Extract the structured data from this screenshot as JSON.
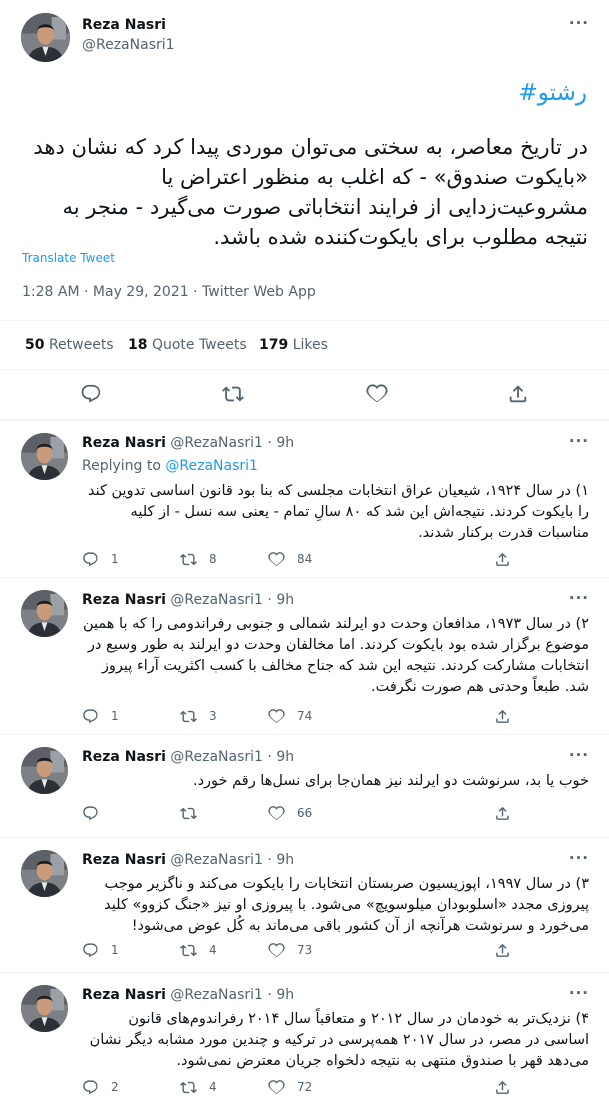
{
  "main_tweet": {
    "author_name": "Reza Nasri",
    "author_handle": "@RezaNasri1",
    "hashtag": "#رشتو",
    "text": "در تاریخ معاصر، به سختی می‌توان موردی پیدا کرد که نشان دهد «بایکوت صندوق» - که اغلب به منظور اعتراض یا مشروعیت‌زدایی از فرایند انتخاباتی صورت می‌گیرد - منجر به نتیجه مطلوب برای بایکوت‌کننده شده باشد.",
    "translate_label": "Translate Tweet",
    "time": "1:28 AM",
    "dot": "·",
    "date": "May 29, 2021",
    "source": "Twitter Web App",
    "retweets_count": "50",
    "retweets_label": "Retweets",
    "quotes_count": "18",
    "quotes_label": "Quote Tweets",
    "likes_count": "179",
    "likes_label": "Likes",
    "more_label": "···"
  },
  "replies": [
    {
      "name": "Reza Nasri",
      "handle": "@RezaNasri1",
      "dot": "·",
      "time": "9h",
      "replying_label": "Replying to",
      "replying_handle": "@RezaNasri1",
      "text": "۱) در سال ۱۹۲۴، شیعیان عراق انتخابات مجلسی که بنا بود قانون اساسی تدوین کند را بایکوت کردند. نتیجه‌اش این شد که ۸۰ سالِ تمام - یعنی سه نسل - از کلیه مناسبات قدرت برکنار شدند.",
      "reply_count": "1",
      "retweet_count": "8",
      "like_count": "84"
    },
    {
      "name": "Reza Nasri",
      "handle": "@RezaNasri1",
      "dot": "·",
      "time": "9h",
      "text": "۲) در سال ۱۹۷۳، مدافعان وحدت دو ایرلند شمالی و جنوبی رفراندومی را که با همین موضوع برگزار شده بود بایکوت کردند. اما مخالفان وحدت دو ایرلند به طور وسیع در انتخابات مشارکت کردند. نتیجه این شد که جناح مخالف با کسب اکثریت آراء پیروز شد. طبعاً وحدتی هم صورت نگرفت.",
      "reply_count": "1",
      "retweet_count": "3",
      "like_count": "74"
    },
    {
      "name": "Reza Nasri",
      "handle": "@RezaNasri1",
      "dot": "·",
      "time": "9h",
      "text": "خوب یا بد، سرنوشت دو ایرلند نیز همان‌جا برای نسل‌ها رقم خورد.",
      "reply_count": "",
      "retweet_count": "",
      "like_count": "66"
    },
    {
      "name": "Reza Nasri",
      "handle": "@RezaNasri1",
      "dot": "·",
      "time": "9h",
      "text": "۳) در سال ۱۹۹۷، اپوزیسیون صربستان انتخابات را بایکوت می‌کند و ناگزیر موجب پیروزی مجدد «اسلوبودان میلوسویچ» می‌شود. با پیروزی او نیز «جنگ کزوو» کلید می‌خورد و سرنوشت هرآنچه از آن کشور باقی می‌ماند به کُل عوض می‌شود!",
      "reply_count": "1",
      "retweet_count": "4",
      "like_count": "73"
    },
    {
      "name": "Reza Nasri",
      "handle": "@RezaNasri1",
      "dot": "·",
      "time": "9h",
      "text": "۴) نزدیک‌تر به خودمان در سال ۲۰۱۲ و متعاقباً سال ۲۰۱۴ رفراندوم‌های قانون اساسی در مصر، در سال ۲۰۱۷ همه‌پرسی در ترکیه و چندین مورد مشابه دیگر نشان می‌دهد قهر با صندوق منتهی به نتیجه دلخواه جریان معترض نمی‌شود.",
      "reply_count": "2",
      "retweet_count": "4",
      "like_count": "72"
    }
  ],
  "icons": {
    "reply": "reply-icon",
    "retweet": "retweet-icon",
    "like": "heart-icon",
    "share": "share-icon",
    "more": "more-icon"
  },
  "colors": {
    "accent": "#1d9bf0",
    "text": "#0f1419",
    "secondary": "#536471",
    "divider": "#eff3f4"
  }
}
